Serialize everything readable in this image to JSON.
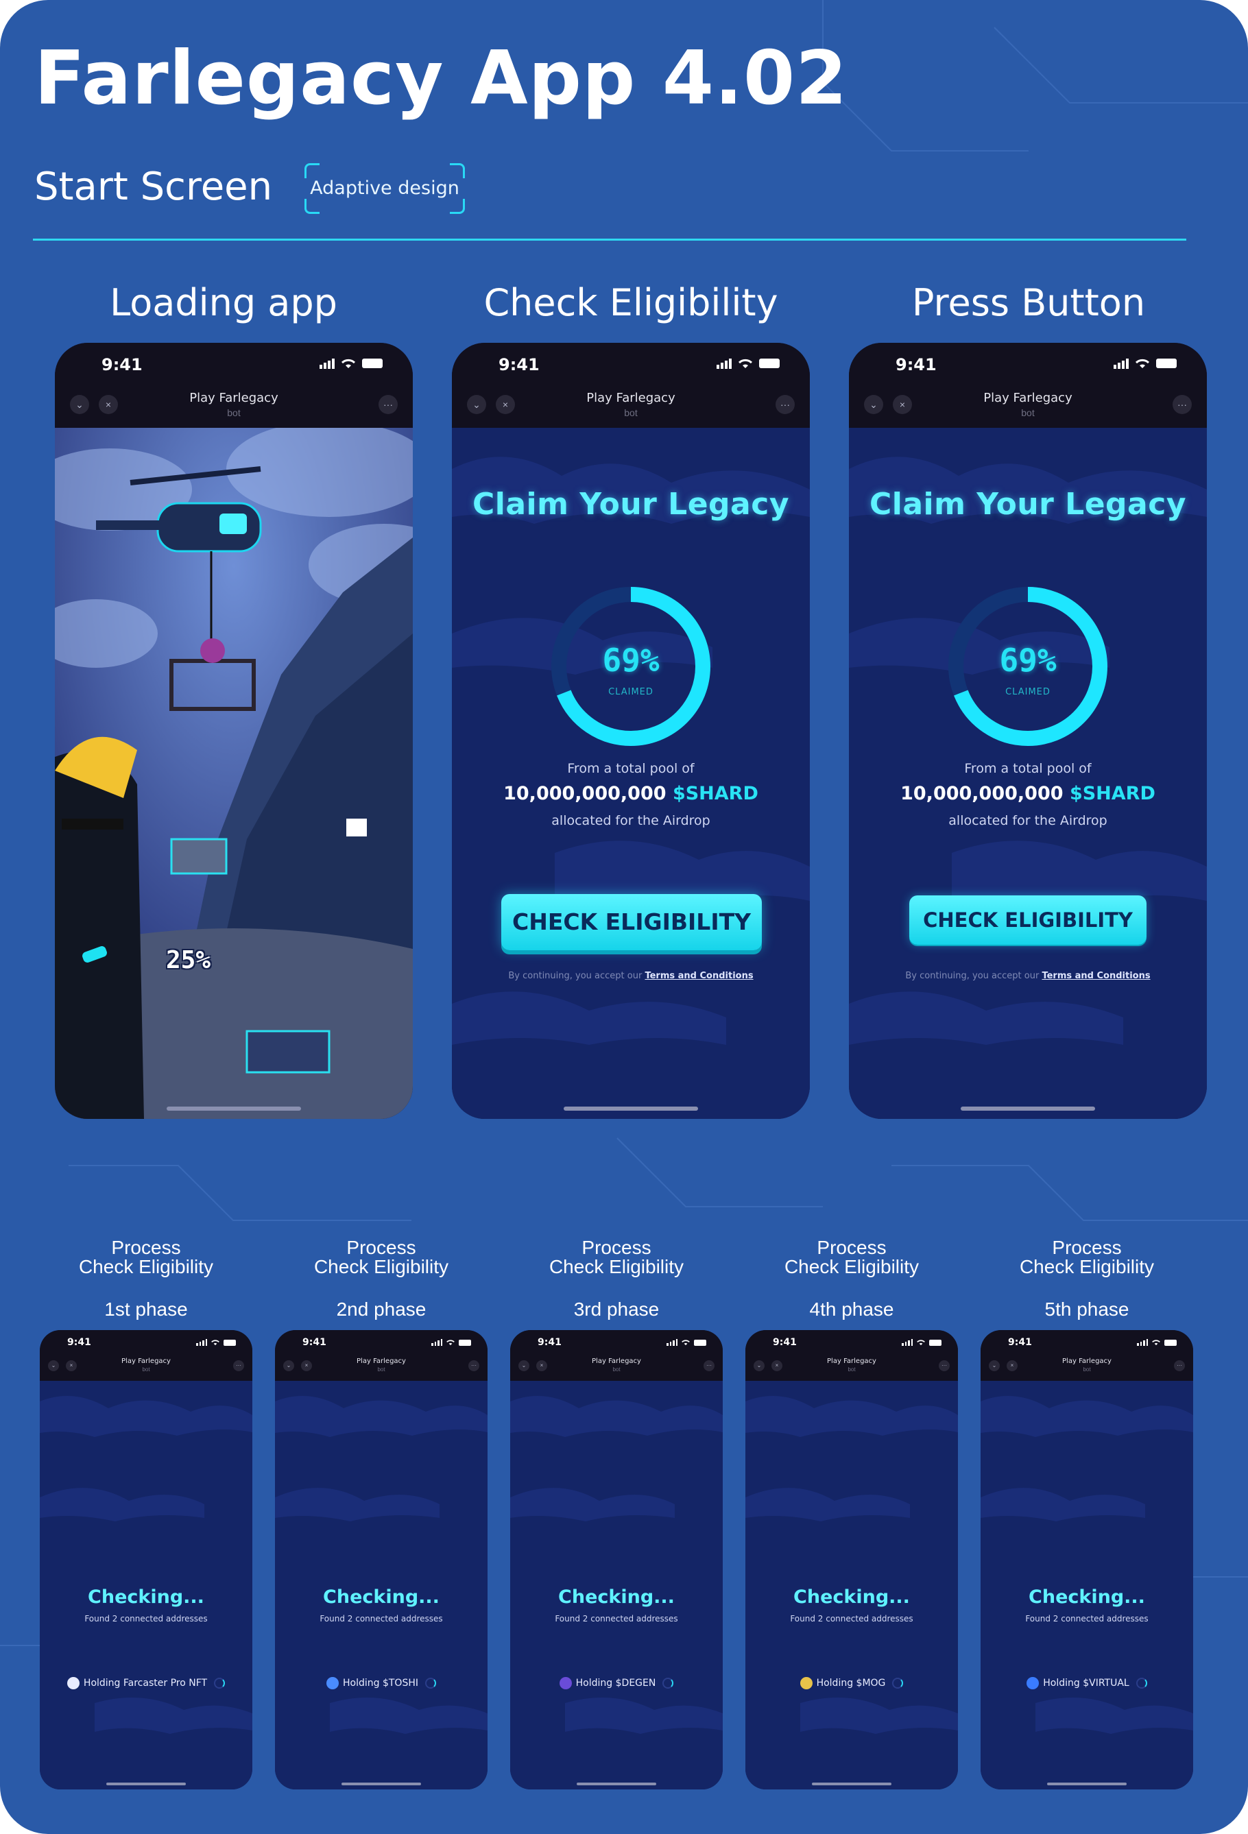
{
  "header": {
    "title": "Farlegacy App 4.02",
    "section": "Start Screen",
    "tag": "Adaptive design"
  },
  "colors": {
    "background": "#2a5aa8",
    "accent": "#29d9f5",
    "screen_bg": "#142566",
    "status_bar": "#12101e"
  },
  "columns": {
    "loading": "Loading app",
    "check": "Check Eligibility",
    "press": "Press Button"
  },
  "device": {
    "time": "9:41",
    "bot_title": "Play Farlegacy",
    "bot_sub": "bot",
    "close_icon": "×",
    "back_icon": "⌄",
    "more_icon": "···"
  },
  "loading": {
    "percent_label": "25%",
    "progress": 0.28
  },
  "claim": {
    "title": "Claim Your Legacy",
    "percent": "69%",
    "percent_value": 0.69,
    "claimed_label": "CLAIMED",
    "pool_intro": "From a total pool of",
    "pool_amount": "10,000,000,000",
    "pool_token": "$SHARD",
    "pool_outro": "allocated for the Airdrop",
    "button": "CHECK ELIGIBILITY",
    "terms_prefix": "By continuing, you accept our",
    "terms_link": "Terms and Conditions"
  },
  "process": {
    "title_line1": "Process",
    "title_line2": "Check Eligibility",
    "checking": "Checking...",
    "found": "Found 2 connected addresses",
    "phases": [
      {
        "label": "1st phase",
        "holding": "Holding Farcaster Pro NFT",
        "icon": "farcaster-icon",
        "icon_color": "#e8ecff"
      },
      {
        "label": "2nd phase",
        "holding": "Holding $TOSHI",
        "icon": "toshi-icon",
        "icon_color": "#4a8cff"
      },
      {
        "label": "3rd phase",
        "holding": "Holding $DEGEN",
        "icon": "degen-icon",
        "icon_color": "#6a4cd8"
      },
      {
        "label": "4th phase",
        "holding": "Holding $MOG",
        "icon": "mog-icon",
        "icon_color": "#e8c24a"
      },
      {
        "label": "5th phase",
        "holding": "Holding $VIRTUAL",
        "icon": "virtual-icon",
        "icon_color": "#3a7cff"
      }
    ]
  }
}
